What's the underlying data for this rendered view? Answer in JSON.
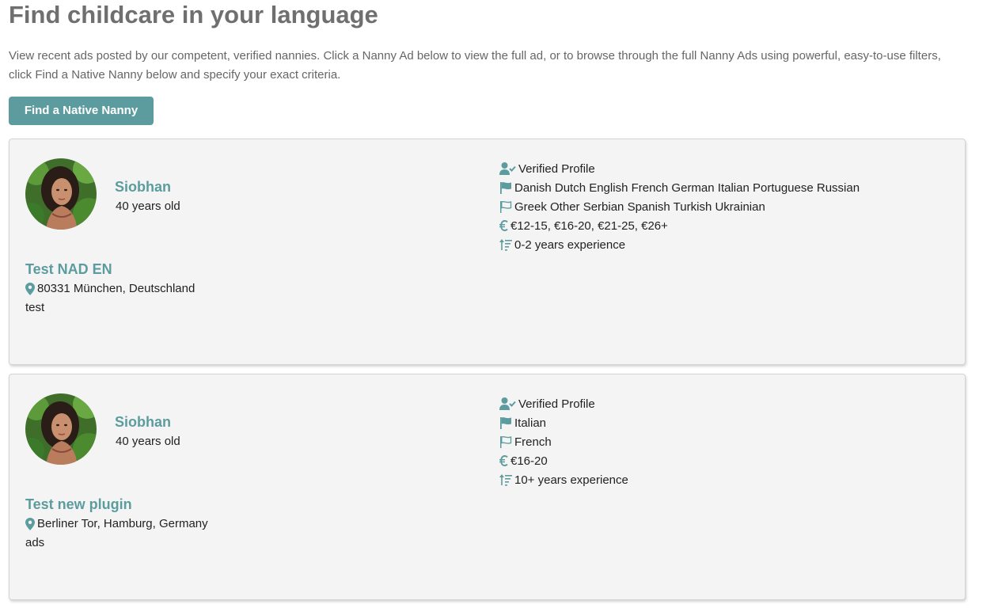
{
  "page": {
    "title": "Find childcare in your language",
    "intro": "View recent ads posted by our competent, verified nannies. Click a Nanny Ad below to view the full ad, or to browse through the full Nanny Ads using powerful, easy-to-use filters, click Find a Native Nanny below and specify your exact criteria.",
    "cta_label": "Find a Native Nanny"
  },
  "theme": {
    "accent": "#5c9c9f",
    "title_color": "#6f6f6f",
    "card_bg": "#f4f4f4"
  },
  "ads": [
    {
      "name": "Siobhan",
      "age": "40 years old",
      "title": "Test NAD EN",
      "location": "80331 München, Deutschland",
      "description": "test",
      "verified": "Verified Profile",
      "native_languages": "Danish Dutch English French German Italian Portuguese Russian",
      "other_languages": "Greek Other Serbian Spanish Turkish Ukrainian",
      "rates": "€12-15, €16-20, €21-25, €26+",
      "experience": "0-2 years experience"
    },
    {
      "name": "Siobhan",
      "age": "40 years old",
      "title": "Test new plugin",
      "location": "Berliner Tor, Hamburg, Germany",
      "description": "ads",
      "verified": "Verified Profile",
      "native_languages": "Italian",
      "other_languages": "French",
      "rates": "€16-20",
      "experience": "10+ years experience"
    }
  ],
  "icons": {
    "verified": "user-check-icon",
    "native_language": "flag-solid-icon",
    "other_language": "flag-outline-icon",
    "rate": "euro-icon",
    "experience": "sort-amount-icon",
    "location": "map-marker-icon"
  }
}
